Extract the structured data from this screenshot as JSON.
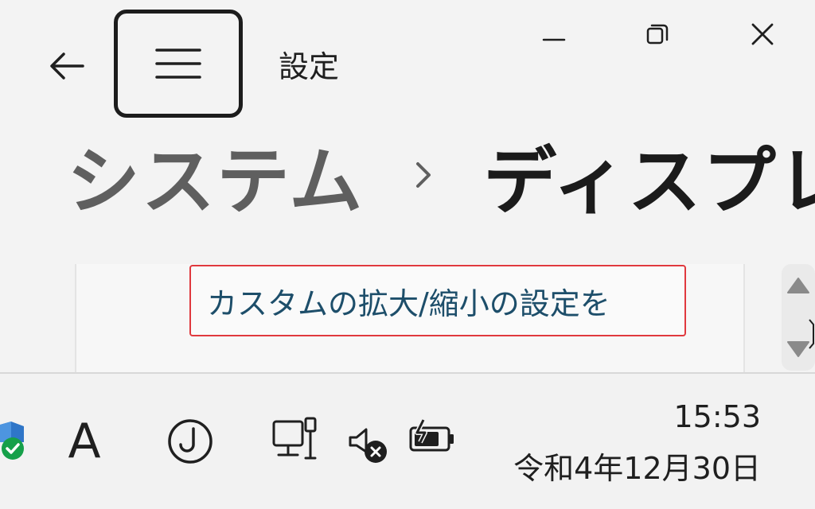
{
  "window": {
    "title": "設定",
    "controls": {
      "minimize_icon": "minimize-icon",
      "maximize_icon": "restore-icon",
      "close_icon": "close-icon"
    }
  },
  "navigation": {
    "back_icon": "back-arrow-icon",
    "menu_icon": "hamburger-menu-icon"
  },
  "breadcrumb": {
    "parent": "システム",
    "separator_icon": "chevron-right-icon",
    "current": "ディスプレイ"
  },
  "content": {
    "link_text": "カスタムの拡大/縮小の設定を"
  },
  "scrollbar": {
    "up_icon": "scroll-up-icon",
    "down_icon": "scroll-down-icon"
  },
  "taskbar": {
    "ime_mode": "A",
    "clock": {
      "time": "15:53",
      "date": "令和4年12月30日"
    }
  },
  "colors": {
    "background": "#f3f3f3",
    "link": "#1d4e6a",
    "highlight_border": "#e0393e",
    "text": "#1f1f1f",
    "breadcrumb_parent": "#5f5f5f"
  }
}
